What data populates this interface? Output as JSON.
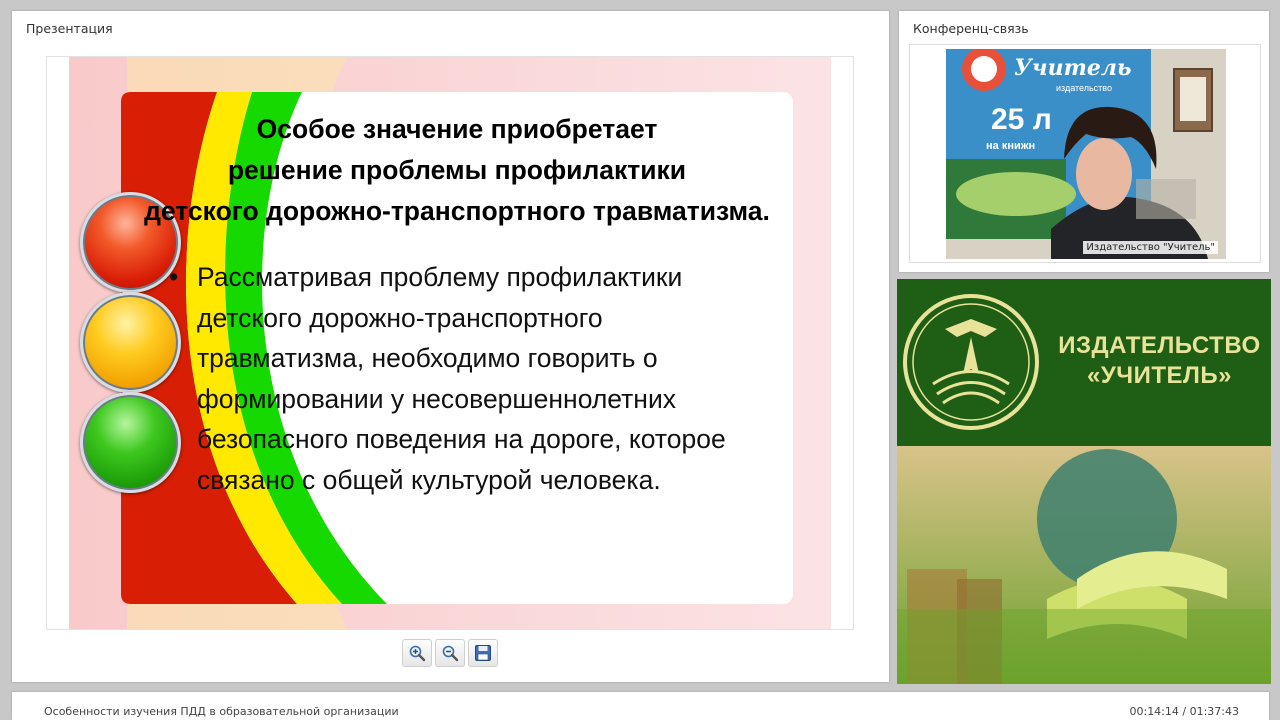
{
  "presentation_panel": {
    "title": "Презентация"
  },
  "slide": {
    "heading_lines": [
      "Особое значение приобретает",
      "решение проблемы профилактики",
      "детского дорожно-транспортного травматизма."
    ],
    "bullet_symbol": "•",
    "bullet_lines": [
      "Рассматривая проблему профилактики",
      "детского дорожно-транспортного",
      "травматизма, необходимо говорить о",
      "формировании у несовершеннолетних",
      "безопасного поведения на дороге, которое",
      "связано с общей культурой человека."
    ]
  },
  "toolbar": {
    "zoom_in_icon": "zoom-in-icon",
    "zoom_out_icon": "zoom-out-icon",
    "save_icon": "floppy-disk-icon"
  },
  "conference_panel": {
    "title": "Конференц-связь",
    "video_caption": "Издательство \"Учитель\""
  },
  "video_poster": {
    "brand": "Учитель",
    "sub": "издательство",
    "number": "25 л",
    "line": "на книжн"
  },
  "banner": {
    "line1": "ИЗДАТЕЛЬСТВО",
    "line2": "«УЧИТЕЛЬ»"
  },
  "footer": {
    "course_title": "Особенности изучения ПДД в образовательной организации",
    "time": "00:14:14 / 01:37:43"
  },
  "colors": {
    "slide_red": "#d81e05",
    "slide_yellow": "#ffe900",
    "slide_green": "#16d900",
    "banner_green": "#1f5e15",
    "banner_text": "#e9e39a"
  }
}
